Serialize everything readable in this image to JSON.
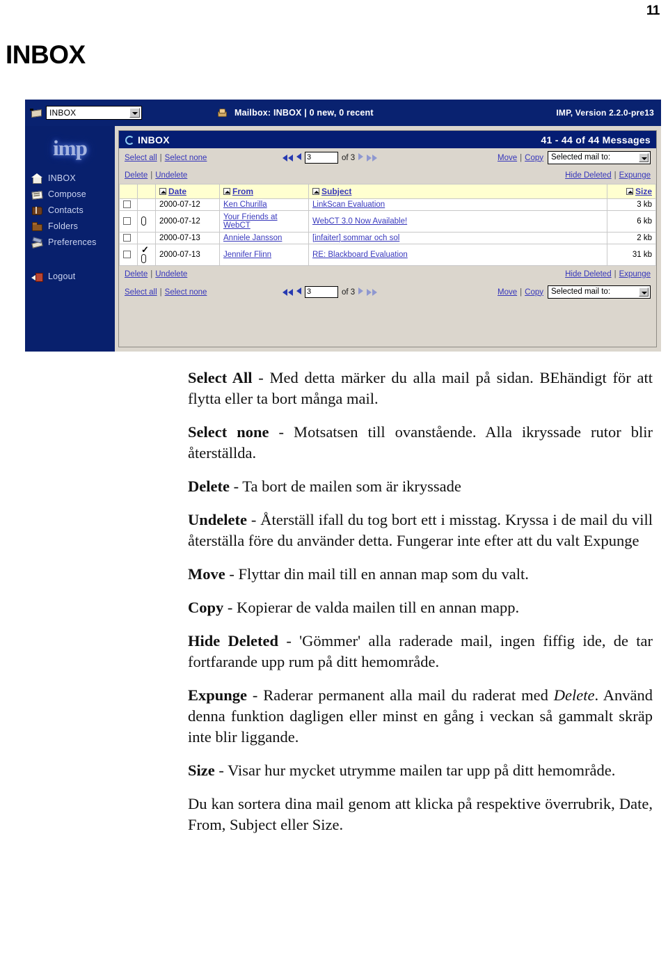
{
  "page": {
    "number": "11",
    "title": "INBOX"
  },
  "screenshot": {
    "topbar": {
      "folder_select_value": "INBOX",
      "mailbox_status": "Mailbox: INBOX  |  0 new, 0 recent",
      "version": "IMP, Version 2.2.0-pre13"
    },
    "sidebar": {
      "logo": "imp",
      "items": [
        {
          "label": "INBOX",
          "icon": "home-icon"
        },
        {
          "label": "Compose",
          "icon": "envelope-icon"
        },
        {
          "label": "Contacts",
          "icon": "book-icon"
        },
        {
          "label": "Folders",
          "icon": "folder-icon"
        },
        {
          "label": "Preferences",
          "icon": "tools-icon"
        },
        {
          "label": "Logout",
          "icon": "logout-icon"
        }
      ]
    },
    "panel": {
      "title": "INBOX",
      "message_count": "41 - 44 of 44 Messages"
    },
    "toolbar": {
      "select_all": "Select all",
      "select_none": "Select none",
      "separator": "|",
      "delete": "Delete",
      "undelete": "Undelete",
      "hide_deleted": "Hide Deleted",
      "expunge": "Expunge",
      "move": "Move",
      "copy": "Copy",
      "mail_to_select": "Selected mail to:",
      "page_value": "3",
      "page_of": "of 3"
    },
    "table": {
      "columns": [
        "Date",
        "From",
        "Subject",
        "Size"
      ],
      "rows": [
        {
          "checked": false,
          "flags": "",
          "date": "2000-07-12",
          "from": "Ken Churilla",
          "subject": "LinkScan Evaluation",
          "size": "3 kb"
        },
        {
          "checked": false,
          "flags": "attachment",
          "date": "2000-07-12",
          "from": "Your Friends at WebCT",
          "subject": "WebCT 3.0 Now Available!",
          "size": "6 kb"
        },
        {
          "checked": false,
          "flags": "",
          "date": "2000-07-13",
          "from": "Anniele Jansson",
          "subject": "[infaiter] sommar och sol",
          "size": "2 kb"
        },
        {
          "checked": false,
          "flags": "answered-attachment",
          "date": "2000-07-13",
          "from": "Jennifer Flinn",
          "subject": "RE: Blackboard Evaluation",
          "size": "31 kb"
        }
      ]
    }
  },
  "prose": {
    "p1_term": "Select All",
    "p1_text": " - Med detta märker du alla mail på sidan. BEhändigt för att flytta eller ta bort många mail.",
    "p2_term": "Select none",
    "p2_text": " - Motsatsen till ovanstående. Alla ikryssade rutor blir återställda.",
    "p3_term": "Delete",
    "p3_text": " - Ta bort de mailen som är ikryssade",
    "p4_term": "Undelete",
    "p4_text": " - Återställ ifall du tog bort ett i misstag. Kryssa i de mail du vill återställa före du använder detta. Fungerar inte efter att du valt Expunge",
    "p5_term": "Move",
    "p5_text": " - Flyttar din mail till en annan map som du valt.",
    "p6_term": "Copy",
    "p6_text": " - Kopierar de valda mailen till en annan mapp.",
    "p7_term": "Hide Deleted",
    "p7_text": " - 'Gömmer' alla raderade mail, ingen fiffig ide, de tar fortfarande upp rum på ditt hemområde.",
    "p8_term": "Expunge",
    "p8_text_a": " - Raderar permanent alla mail du raderat med ",
    "p8_italic": "Delete",
    "p8_text_b": ". Använd denna funktion dagligen eller minst en gång i veckan så gammalt skräp inte blir liggande.",
    "p9_term": "Size",
    "p9_text": " - Visar hur mycket utrymme mailen tar upp på ditt hemområde.",
    "p10_text": "Du kan sortera dina mail genom att klicka på respektive överrubrik, Date, From, Subject eller Size."
  },
  "colors": {
    "imp_blue": "#12276b",
    "panel_blue": "#0f2470",
    "link": "#3b3bb0",
    "header_row": "#ffffcc",
    "chrome": "#d4d0c8"
  }
}
